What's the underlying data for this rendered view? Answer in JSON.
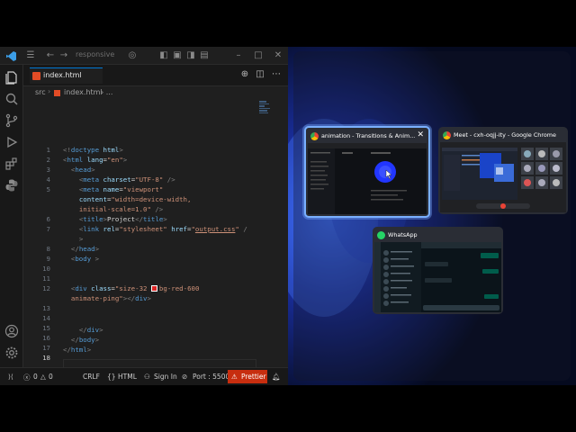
{
  "titlebar": {
    "search": "responsive"
  },
  "tab": {
    "label": "index.html"
  },
  "breadcrumb": {
    "folder": "src",
    "separator": "›",
    "file": "index.html",
    "more": "› ..."
  },
  "editor": {
    "line_numbers": [
      "1",
      "2",
      "3",
      "4",
      "5",
      "",
      "",
      "6",
      "7",
      "",
      "8",
      "9",
      "10",
      "11",
      "12",
      "",
      "13",
      "14",
      "15",
      "16",
      "17",
      "18"
    ],
    "current_line": "18"
  },
  "statusbar": {
    "problems_errors": "0",
    "problems_warnings": "0",
    "eol": "CRLF",
    "language": "HTML",
    "sign_in": "Sign In",
    "port": "Port : 5500",
    "prettier": "Prettier"
  },
  "switcher": {
    "windows": [
      {
        "title": "animation - Transitions & Anim...",
        "app": "chrome"
      },
      {
        "title": "Meet - cxh-oqjj-ity - Google Chrome",
        "app": "chrome"
      },
      {
        "title": "WhatsApp",
        "app": "whatsapp"
      }
    ]
  },
  "colors": {
    "accent": "#0078d4",
    "prettier_bg": "#c72e0f",
    "selection_border": "#7ab0ff"
  }
}
